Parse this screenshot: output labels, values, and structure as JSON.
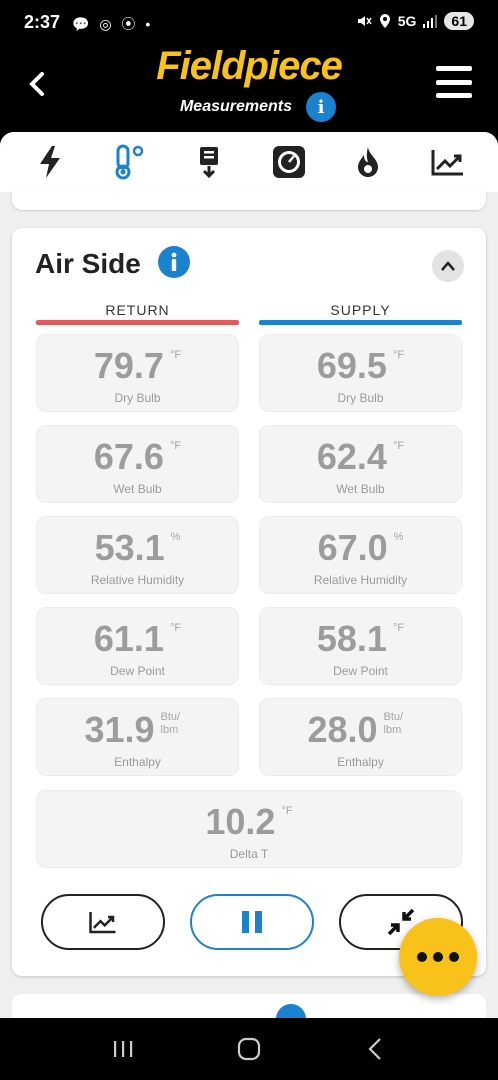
{
  "status_bar": {
    "time": "2:37",
    "notifications": "💬 ◎ ⦿ •",
    "network": "5G",
    "battery": "61"
  },
  "header": {
    "brand": "Fieldpiece",
    "subtitle": "Measurements",
    "info_glyph": "i"
  },
  "tabs": [
    {
      "name": "electrical-tab",
      "icon": "lightning-icon",
      "active": false
    },
    {
      "name": "temperature-tab",
      "icon": "thermometer-icon",
      "active": true
    },
    {
      "name": "duct-tab",
      "icon": "filter-icon",
      "active": false
    },
    {
      "name": "pressure-tab",
      "icon": "gauge-icon",
      "active": false
    },
    {
      "name": "combustion-tab",
      "icon": "flame-icon",
      "active": false
    },
    {
      "name": "graph-tab",
      "icon": "trend-icon",
      "active": false
    }
  ],
  "card": {
    "title": "Air Side",
    "info_glyph": "i",
    "return_label": "RETURN",
    "supply_label": "SUPPLY",
    "return_color": "#e45a5a",
    "supply_color": "#1a82cf",
    "rows": [
      {
        "label": "Dry Bulb",
        "return": "79.7",
        "supply": "69.5",
        "unit": "°F"
      },
      {
        "label": "Wet Bulb",
        "return": "67.6",
        "supply": "62.4",
        "unit": "°F"
      },
      {
        "label": "Relative Humidity",
        "return": "53.1",
        "supply": "67.0",
        "unit": "%"
      },
      {
        "label": "Dew Point",
        "return": "61.1",
        "supply": "58.1",
        "unit": "°F"
      },
      {
        "label": "Enthalpy",
        "return": "31.9",
        "supply": "28.0",
        "unit": "Btu/ lbm"
      }
    ],
    "delta": {
      "label": "Delta T",
      "value": "10.2",
      "unit": "°F"
    }
  },
  "colors": {
    "brand_yellow": "#f9c21b",
    "accent_blue": "#1a82cf"
  }
}
